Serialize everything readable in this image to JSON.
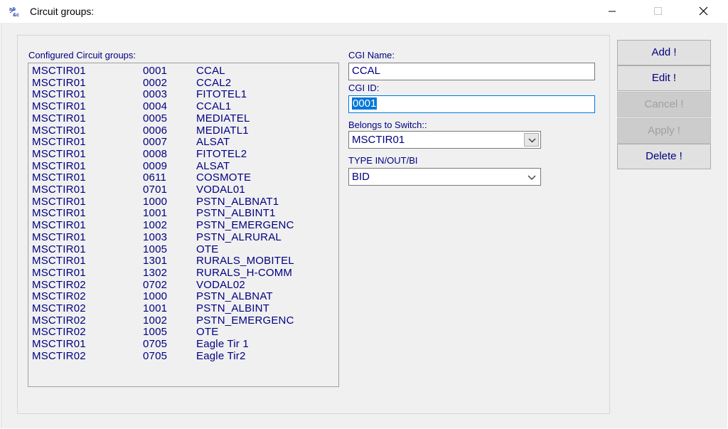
{
  "window": {
    "title": "Circuit groups:"
  },
  "list": {
    "label": "Configured Circuit groups:",
    "rows": [
      [
        "MSCTIR01",
        "0001",
        "CCAL"
      ],
      [
        "MSCTIR01",
        "0002",
        "CCAL2"
      ],
      [
        "MSCTIR01",
        "0003",
        "FITOTEL1"
      ],
      [
        "MSCTIR01",
        "0004",
        "CCAL1"
      ],
      [
        "MSCTIR01",
        "0005",
        "MEDIATEL"
      ],
      [
        "MSCTIR01",
        "0006",
        "MEDIATL1"
      ],
      [
        "MSCTIR01",
        "0007",
        "ALSAT"
      ],
      [
        "MSCTIR01",
        "0008",
        "FITOTEL2"
      ],
      [
        "MSCTIR01",
        "0009",
        "ALSAT"
      ],
      [
        "MSCTIR01",
        "0611",
        "COSMOTE"
      ],
      [
        "MSCTIR01",
        "0701",
        "VODAL01"
      ],
      [
        "MSCTIR01",
        "1000",
        "PSTN_ALBNAT1"
      ],
      [
        "MSCTIR01",
        "1001",
        "PSTN_ALBINT1"
      ],
      [
        "MSCTIR01",
        "1002",
        "PSTN_EMERGENC"
      ],
      [
        "MSCTIR01",
        "1003",
        "PSTN_ALRURAL"
      ],
      [
        "MSCTIR01",
        "1005",
        "OTE"
      ],
      [
        "MSCTIR01",
        "1301",
        "RURALS_MOBITEL"
      ],
      [
        "MSCTIR01",
        "1302",
        "RURALS_H-COMM"
      ],
      [
        "MSCTIR02",
        "0702",
        "VODAL02"
      ],
      [
        "MSCTIR02",
        "1000",
        "PSTN_ALBNAT"
      ],
      [
        "MSCTIR02",
        "1001",
        "PSTN_ALBINT"
      ],
      [
        "MSCTIR02",
        "1002",
        "PSTN_EMERGENC"
      ],
      [
        "MSCTIR02",
        "1005",
        "OTE"
      ],
      [
        "MSCTIR01",
        "0705",
        "Eagle Tir 1"
      ],
      [
        "MSCTIR02",
        "0705",
        "Eagle Tir2"
      ]
    ]
  },
  "form": {
    "cgi_name_label": "CGI Name:",
    "cgi_name_value": "CCAL",
    "cgi_id_label": "CGI ID:",
    "cgi_id_value": "0001",
    "switch_label": "Belongs to Switch::",
    "switch_value": "MSCTIR01",
    "type_label": "TYPE IN/OUT/BI",
    "type_value": "BID"
  },
  "buttons": {
    "add": "Add !",
    "edit": "Edit !",
    "cancel": "Cancel !",
    "apply": "Apply !",
    "delete": "Delete !"
  },
  "icons": {
    "app": "app-icon",
    "minimize": "minimize-icon",
    "maximize": "maximize-icon",
    "close": "close-icon"
  }
}
